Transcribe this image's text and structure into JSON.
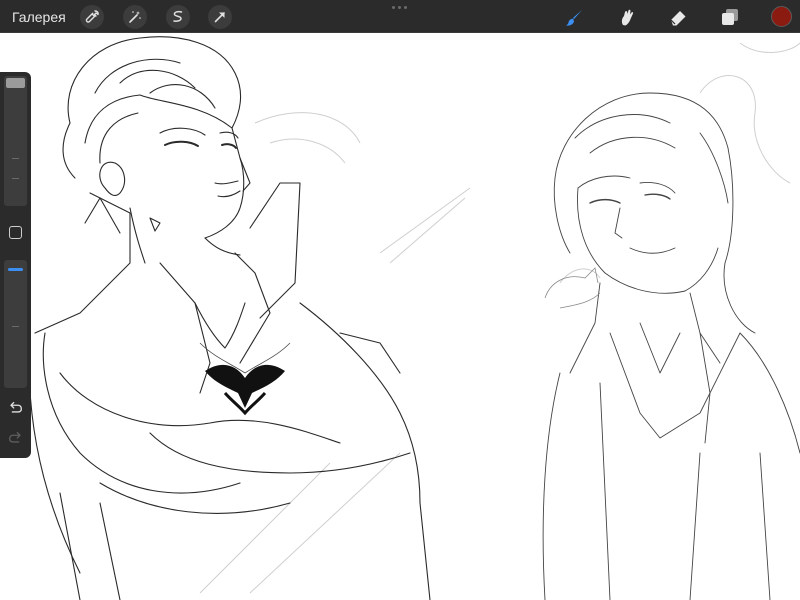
{
  "topbar": {
    "gallery_label": "Галерея",
    "left_tools": [
      "wrench-icon",
      "magic-wand-icon",
      "selection-icon",
      "transform-arrow-icon"
    ],
    "right_tools": [
      "brush-icon",
      "smudge-icon",
      "eraser-icon",
      "layers-icon"
    ],
    "active_tool": "brush-icon",
    "accent_color": "#3b8ef2",
    "current_color": "#8b1a10"
  },
  "sidebar": {
    "brush_size_slider": 1.0,
    "opacity_slider": 1.0,
    "modify_button_icon": "square-icon",
    "undo_icon": "undo-icon",
    "redo_icon": "redo-icon"
  },
  "canvas": {
    "description_icons": [
      "sketch-figure-left",
      "sketch-figure-right"
    ]
  }
}
